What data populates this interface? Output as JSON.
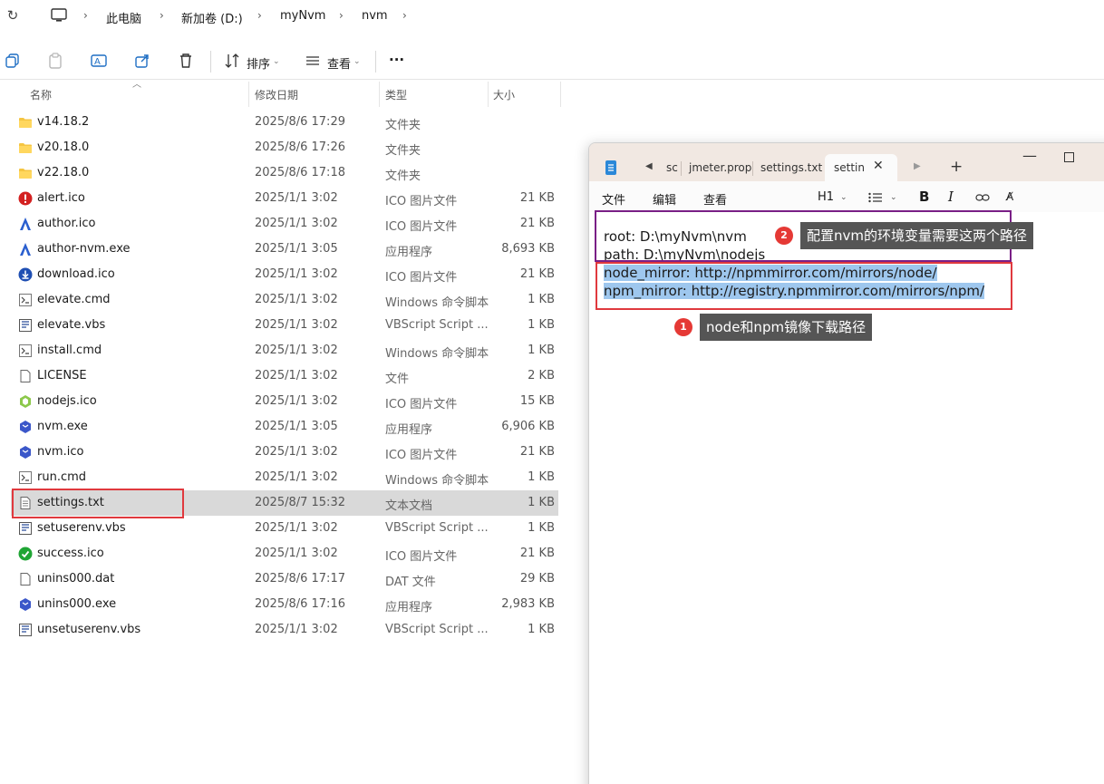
{
  "breadcrumb": [
    "此电脑",
    "新加卷 (D:)",
    "myNvm",
    "nvm"
  ],
  "toolbar": {
    "sort_label": "排序",
    "view_label": "查看",
    "more_label": "···"
  },
  "columns": {
    "name": "名称",
    "modified": "修改日期",
    "type": "类型",
    "size": "大小"
  },
  "files": [
    {
      "name": "v14.18.2",
      "date": "2025/8/6 17:29",
      "type": "文件夹",
      "size": "",
      "icon": "folder-icon"
    },
    {
      "name": "v20.18.0",
      "date": "2025/8/6 17:26",
      "type": "文件夹",
      "size": "",
      "icon": "folder-icon"
    },
    {
      "name": "v22.18.0",
      "date": "2025/8/6 17:18",
      "type": "文件夹",
      "size": "",
      "icon": "folder-icon"
    },
    {
      "name": "alert.ico",
      "date": "2025/1/1 3:02",
      "type": "ICO 图片文件",
      "size": "21 KB",
      "icon": "alert-icon"
    },
    {
      "name": "author.ico",
      "date": "2025/1/1 3:02",
      "type": "ICO 图片文件",
      "size": "21 KB",
      "icon": "author-icon"
    },
    {
      "name": "author-nvm.exe",
      "date": "2025/1/1 3:05",
      "type": "应用程序",
      "size": "8,693 KB",
      "icon": "author-icon"
    },
    {
      "name": "download.ico",
      "date": "2025/1/1 3:02",
      "type": "ICO 图片文件",
      "size": "21 KB",
      "icon": "download-icon"
    },
    {
      "name": "elevate.cmd",
      "date": "2025/1/1 3:02",
      "type": "Windows 命令脚本",
      "size": "1 KB",
      "icon": "script-icon"
    },
    {
      "name": "elevate.vbs",
      "date": "2025/1/1 3:02",
      "type": "VBScript Script ...",
      "size": "1 KB",
      "icon": "vbs-icon"
    },
    {
      "name": "install.cmd",
      "date": "2025/1/1 3:02",
      "type": "Windows 命令脚本",
      "size": "1 KB",
      "icon": "script-icon"
    },
    {
      "name": "LICENSE",
      "date": "2025/1/1 3:02",
      "type": "文件",
      "size": "2 KB",
      "icon": "file-icon"
    },
    {
      "name": "nodejs.ico",
      "date": "2025/1/1 3:02",
      "type": "ICO 图片文件",
      "size": "15 KB",
      "icon": "nodejs-icon"
    },
    {
      "name": "nvm.exe",
      "date": "2025/1/1 3:05",
      "type": "应用程序",
      "size": "6,906 KB",
      "icon": "nvm-icon"
    },
    {
      "name": "nvm.ico",
      "date": "2025/1/1 3:02",
      "type": "ICO 图片文件",
      "size": "21 KB",
      "icon": "nvm-icon"
    },
    {
      "name": "run.cmd",
      "date": "2025/1/1 3:02",
      "type": "Windows 命令脚本",
      "size": "1 KB",
      "icon": "script-icon"
    },
    {
      "name": "settings.txt",
      "date": "2025/8/7 15:32",
      "type": "文本文档",
      "size": "1 KB",
      "icon": "text-file-icon",
      "selected": true
    },
    {
      "name": "setuserenv.vbs",
      "date": "2025/1/1 3:02",
      "type": "VBScript Script ...",
      "size": "1 KB",
      "icon": "vbs-icon"
    },
    {
      "name": "success.ico",
      "date": "2025/1/1 3:02",
      "type": "ICO 图片文件",
      "size": "21 KB",
      "icon": "success-icon"
    },
    {
      "name": "unins000.dat",
      "date": "2025/8/6 17:17",
      "type": "DAT 文件",
      "size": "29 KB",
      "icon": "file-icon"
    },
    {
      "name": "unins000.exe",
      "date": "2025/8/6 17:16",
      "type": "应用程序",
      "size": "2,983 KB",
      "icon": "nvm-icon"
    },
    {
      "name": "unsetuserenv.vbs",
      "date": "2025/1/1 3:02",
      "type": "VBScript Script ...",
      "size": "1 KB",
      "icon": "vbs-icon"
    }
  ],
  "notepad": {
    "tabs": [
      "sc",
      "jmeter.prope",
      "settings.txt",
      "settin"
    ],
    "menu": [
      "文件",
      "编辑",
      "查看"
    ],
    "heading_label": "H1",
    "lines": [
      "root: D:\\myNvm\\nvm",
      "path: D:\\myNvm\\nodejs",
      "node_mirror: http://npmmirror.com/mirrors/node/",
      "npm_mirror: http://registry.npmmirror.com/mirrors/npm/"
    ]
  },
  "annotations": [
    {
      "number": "2",
      "text": "配置nvm的环境变量需要这两个路径"
    },
    {
      "number": "1",
      "text": "node和npm镜像下载路径"
    }
  ],
  "colors": {
    "red_box": "#e0393e",
    "purple_box": "#7a1f86",
    "highlight": "#9ec7ee",
    "callout_bg": "#555555"
  }
}
